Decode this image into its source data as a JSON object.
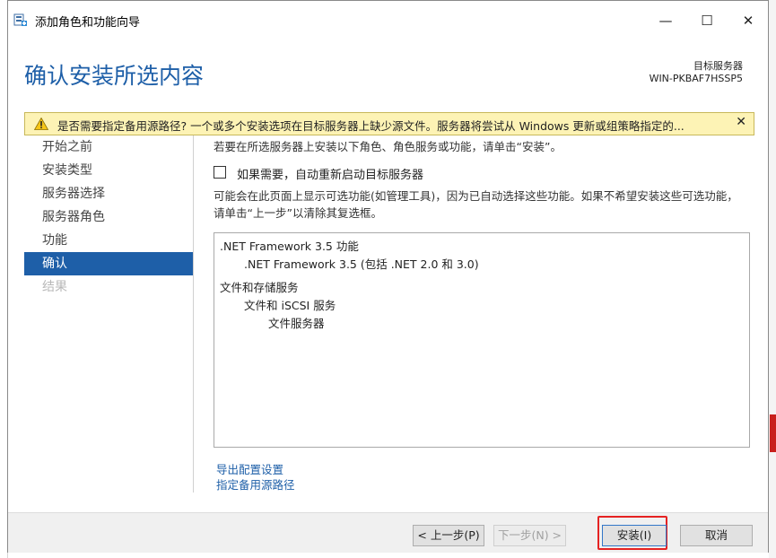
{
  "window": {
    "title": "添加角色和功能向导",
    "controls": {
      "minimize": "—",
      "maximize": "☐",
      "close": "✕"
    }
  },
  "header": {
    "page_title": "确认安装所选内容",
    "dest_label": "目标服务器",
    "dest_server": "WIN-PKBAF7HSSP5"
  },
  "warning": {
    "text": "是否需要指定备用源路径? 一个或多个安装选项在目标服务器上缺少源文件。服务器将尝试从 Windows 更新或组策略指定的...",
    "close": "✕",
    "icon": "warning-icon"
  },
  "nav": {
    "items": [
      {
        "label": "开始之前",
        "state": "normal"
      },
      {
        "label": "安装类型",
        "state": "normal"
      },
      {
        "label": "服务器选择",
        "state": "normal"
      },
      {
        "label": "服务器角色",
        "state": "normal"
      },
      {
        "label": "功能",
        "state": "normal"
      },
      {
        "label": "确认",
        "state": "active"
      },
      {
        "label": "结果",
        "state": "disabled"
      }
    ]
  },
  "main": {
    "intro": "若要在所选服务器上安装以下角色、角色服务或功能，请单击“安装”。",
    "restart_checkbox_label": "如果需要，自动重新启动目标服务器",
    "restart_checked": false,
    "note": "可能会在此页面上显示可选功能(如管理工具)，因为已自动选择这些功能。如果不希望安装这些可选功能，请单击“上一步”以清除其复选框。",
    "items": [
      {
        "text": ".NET Framework 3.5 功能",
        "level": 0
      },
      {
        "text": ".NET Framework 3.5 (包括 .NET 2.0 和 3.0)",
        "level": 1
      },
      {
        "text": "文件和存储服务",
        "level": 0
      },
      {
        "text": "文件和 iSCSI 服务",
        "level": 1
      },
      {
        "text": "文件服务器",
        "level": 2
      }
    ],
    "links": {
      "export": "导出配置设置",
      "alt_source": "指定备用源路径"
    }
  },
  "footer": {
    "prev": "< 上一步(P)",
    "next": "下一步(N) >",
    "install": "安装(I)",
    "cancel": "取消"
  },
  "colors": {
    "accent": "#1e5fa8",
    "warning_bg": "#fdf3b5",
    "highlight": "#e52222"
  }
}
